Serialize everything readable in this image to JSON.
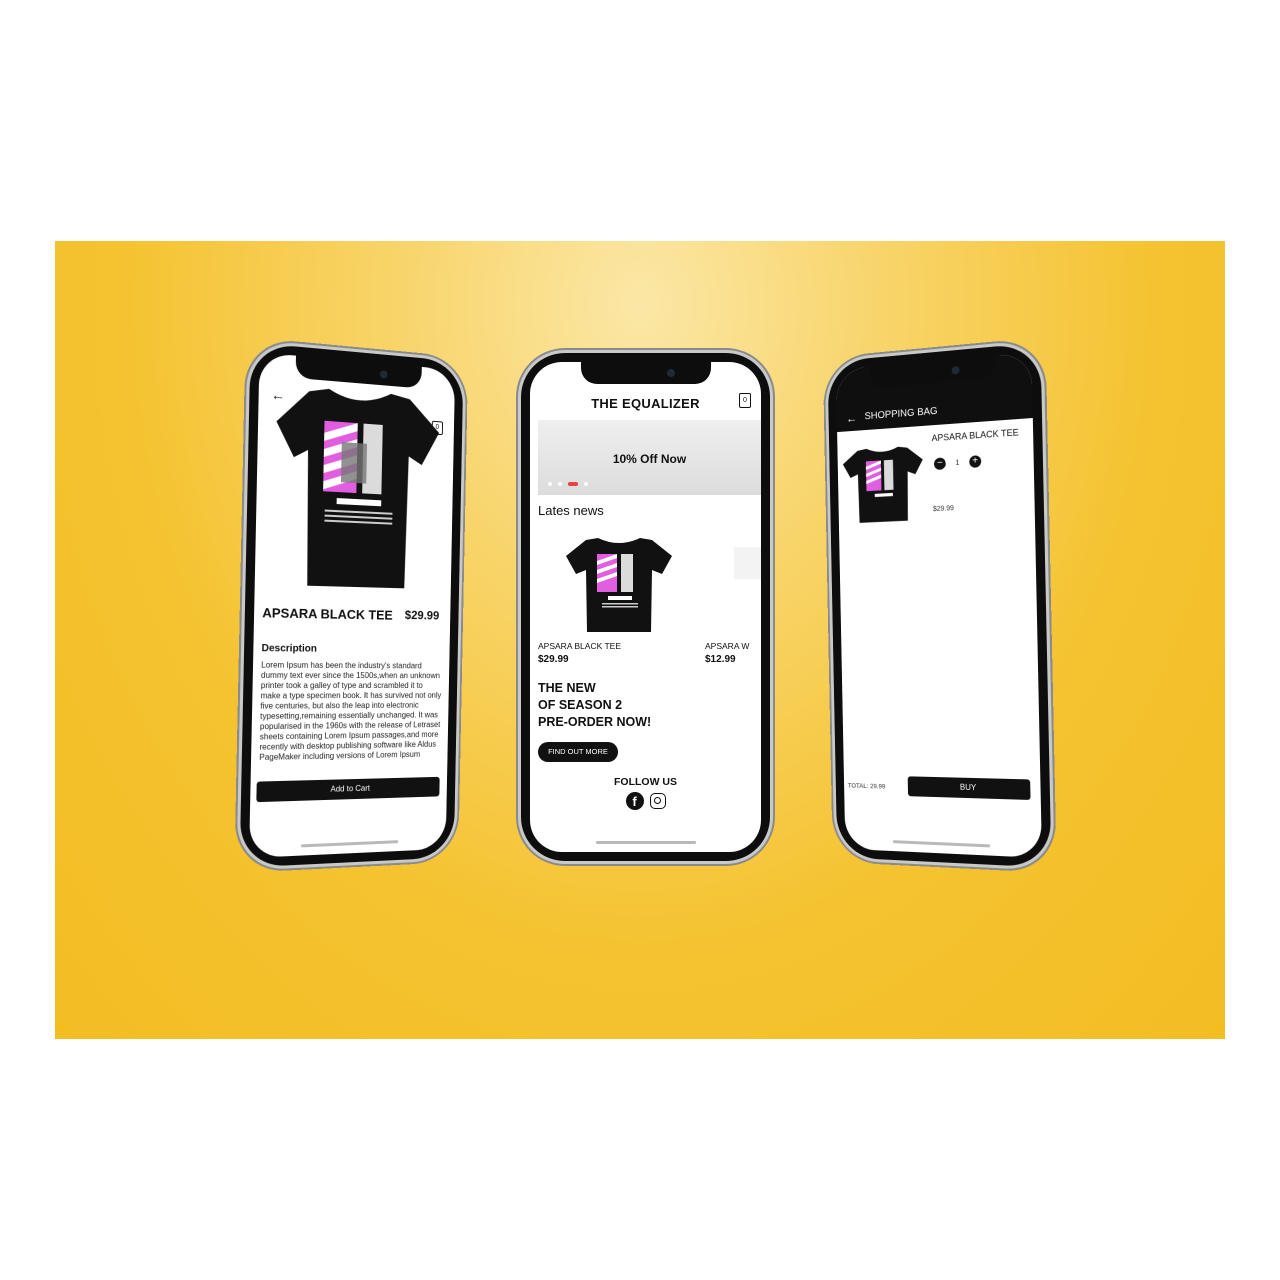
{
  "colors": {
    "backdrop": "#f5c331",
    "accent": "#e8414b",
    "dark": "#111111"
  },
  "product_detail": {
    "back_icon": "arrow-left-icon",
    "bag_count": "0",
    "title": "APSARA BLACK TEE",
    "price": "$29.99",
    "description_heading": "Description",
    "description": "Lorem Ipsum has been the industry's standard dummy text ever since the 1500s,when an unknown printer took a galley of type and scrambled it to make a type specimen book. It has survived not only five centuries, but also the leap into electronic typesetting,remaining essentially unchanged. It was popularised in the 1960s with the release of Letraset sheets containing Lorem Ipsum passages,and more recently with desktop publishing software like Aldus PageMaker including versions of Lorem Ipsum",
    "add_to_cart": "Add to Cart"
  },
  "home": {
    "title": "THE EQUALIZER",
    "bag_count": "0",
    "banner_text": "10% Off Now",
    "carousel_active_index": 2,
    "news_heading": "Lates news",
    "products": [
      {
        "name": "APSARA BLACK TEE",
        "price": "$29.99"
      },
      {
        "name": "APSARA W",
        "price": "$12.99"
      }
    ],
    "promo_lines": [
      "THE NEW",
      "OF SEASON 2",
      "PRE-ORDER NOW!"
    ],
    "find_out_more": "FIND OUT MORE",
    "follow_us": "FOLLOW US",
    "social_icons": [
      "facebook-icon",
      "instagram-icon"
    ]
  },
  "bag": {
    "title": "SHOPPING BAG",
    "item_name": "APSARA BLACK TEE",
    "quantity": "1",
    "item_price": "$29.99",
    "total": "TOTAL: 29.99",
    "buy": "BUY"
  }
}
